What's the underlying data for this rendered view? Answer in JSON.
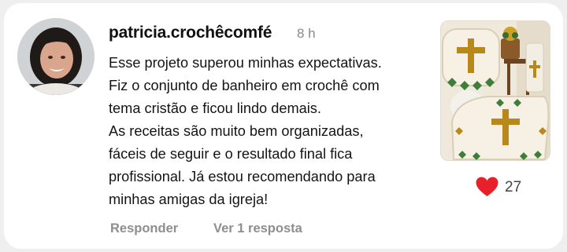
{
  "comment": {
    "username": "patricia.crochêcomfé",
    "time": "8 h",
    "lines": [
      "Esse projeto superou minhas expectativas.",
      "Fiz o conjunto de banheiro em crochê com",
      "tema cristão e ficou lindo demais.",
      "As receitas são muito bem organizadas,",
      "fáceis de seguir e o resultado final fica",
      "profissional. Já estou recomendando para",
      "minhas amigas da igreja!"
    ],
    "likes": "27",
    "reply_label": "Responder",
    "view_replies_label": "Ver 1 resposta"
  },
  "icons": {
    "like": "heart-icon"
  },
  "colors": {
    "heart": "#e8202a",
    "secondary_text": "#8e8e8e",
    "card_bg": "#ffffff",
    "page_bg": "#efefef"
  }
}
